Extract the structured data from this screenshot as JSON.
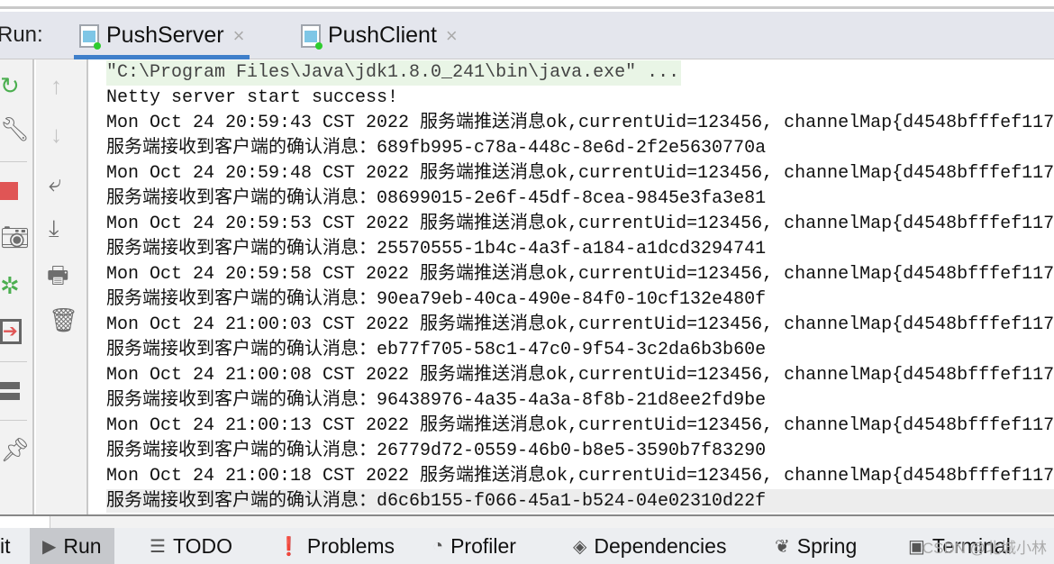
{
  "run_panel": {
    "label": "Run:",
    "tabs": [
      {
        "label": "PushServer",
        "active": true
      },
      {
        "label": "PushClient",
        "active": false
      }
    ],
    "close_glyph": "×"
  },
  "left_toolbar": [
    "rerun-icon",
    "wrench-icon",
    "stop-icon",
    "camera-icon",
    "debug-attach-icon",
    "exit-icon",
    "layout-icon",
    "pin-icon"
  ],
  "console_toolbar": [
    "up-arrow-icon",
    "down-arrow-icon",
    "soft-wrap-icon",
    "scroll-to-end-icon",
    "print-icon",
    "trash-icon"
  ],
  "console": {
    "lines": [
      "\"C:\\Program Files\\Java\\jdk1.8.0_241\\bin\\java.exe\" ...",
      "Netty server start success!",
      "Mon Oct 24 20:59:43 CST 2022 服务端推送消息ok,currentUid=123456, channelMap{d4548bfffef117",
      "服务端接收到客户端的确认消息：689fb995-c78a-448c-8e6d-2f2e5630770a",
      "Mon Oct 24 20:59:48 CST 2022 服务端推送消息ok,currentUid=123456, channelMap{d4548bfffef117",
      "服务端接收到客户端的确认消息：08699015-2e6f-45df-8cea-9845e3fa3e81",
      "Mon Oct 24 20:59:53 CST 2022 服务端推送消息ok,currentUid=123456, channelMap{d4548bfffef117",
      "服务端接收到客户端的确认消息：25570555-1b4c-4a3f-a184-a1dcd3294741",
      "Mon Oct 24 20:59:58 CST 2022 服务端推送消息ok,currentUid=123456, channelMap{d4548bfffef117",
      "服务端接收到客户端的确认消息：90ea79eb-40ca-490e-84f0-10cf132e480f",
      "Mon Oct 24 21:00:03 CST 2022 服务端推送消息ok,currentUid=123456, channelMap{d4548bfffef117",
      "服务端接收到客户端的确认消息：eb77f705-58c1-47c0-9f54-3c2da6b3b60e",
      "Mon Oct 24 21:00:08 CST 2022 服务端推送消息ok,currentUid=123456, channelMap{d4548bfffef117",
      "服务端接收到客户端的确认消息：96438976-4a35-4a3a-8f8b-21d8ee2fd9be",
      "Mon Oct 24 21:00:13 CST 2022 服务端推送消息ok,currentUid=123456, channelMap{d4548bfffef117",
      "服务端接收到客户端的确认消息：26779d72-0559-46b0-b8e5-3590b7f83290",
      "Mon Oct 24 21:00:18 CST 2022 服务端推送消息ok,currentUid=123456, channelMap{d4548bfffef117",
      "服务端接收到客户端的确认消息：d6c6b155-f066-45a1-b524-04e02310d22f"
    ]
  },
  "status_bar": {
    "items": [
      {
        "label": "it",
        "icon": ""
      },
      {
        "label": "Run",
        "icon": "run-icon",
        "active": true
      },
      {
        "label": "TODO",
        "icon": "list-icon"
      },
      {
        "label": "Problems",
        "icon": "problems-icon"
      },
      {
        "label": "Profiler",
        "icon": "profiler-icon"
      },
      {
        "label": "Dependencies",
        "icon": "dependencies-icon"
      },
      {
        "label": "Spring",
        "icon": "spring-icon"
      },
      {
        "label": "Terminal",
        "icon": "terminal-icon"
      }
    ]
  },
  "watermark": "CSDN @北城小林",
  "colors": {
    "accent": "#3f7fca",
    "run_green": "#4caf50",
    "stop_red": "#e05555",
    "cmd_bg": "#e9f5e6"
  }
}
